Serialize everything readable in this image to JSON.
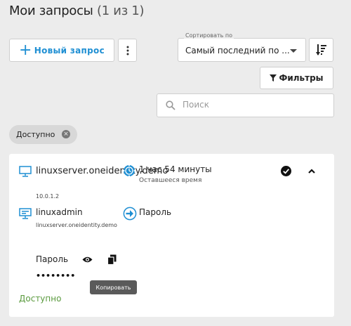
{
  "header": {
    "title": "Мои запросы",
    "count": "(1 из 1)"
  },
  "toolbar": {
    "new_request": "Новый запрос",
    "sort_label": "Сортировать по",
    "sort_value": "Самый последний по ...",
    "filters": "Фильтры",
    "search_placeholder": "Поиск"
  },
  "filter_chip": {
    "label": "Доступно"
  },
  "request": {
    "host_name": "linuxserver.oneidentity.demo",
    "host_ip": "10.0.1.2",
    "time_remaining": "1 час 54 минуты",
    "time_label": "Оставшееся время",
    "account_name": "linuxadmin",
    "account_host": "linuxserver.oneidentity.demo",
    "access_type": "Пароль",
    "password_label": "Пароль",
    "password_masked": "••••••••",
    "copy_tooltip": "Копировать",
    "status": "Доступно"
  },
  "colors": {
    "accent": "#1f8fd3",
    "status_available": "#5a9a3e"
  }
}
